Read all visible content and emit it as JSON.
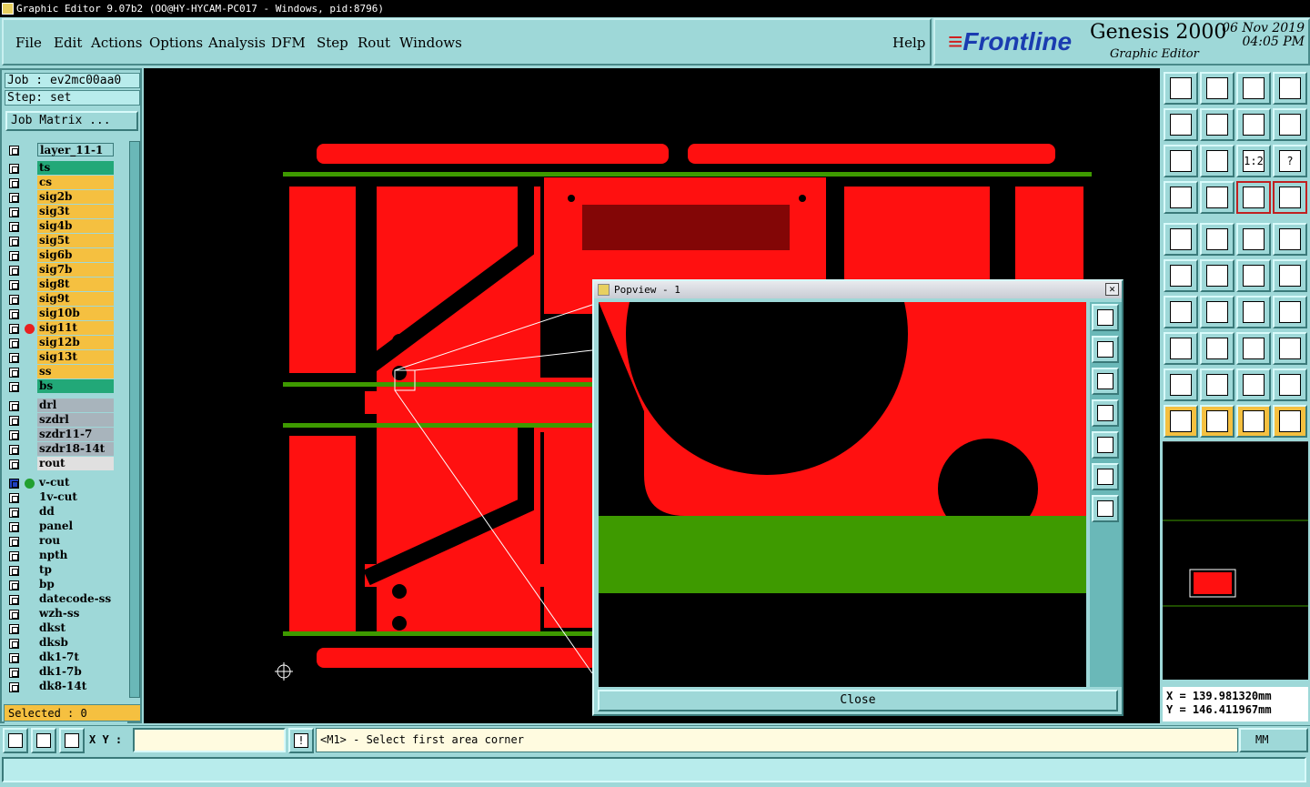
{
  "window": {
    "title": "Graphic Editor 9.07b2 (OO@HY-HYCAM-PC017 - Windows, pid:8796)"
  },
  "menu": {
    "items": [
      "File",
      "Edit",
      "Actions",
      "Options",
      "Analysis",
      "DFM",
      "Step",
      "Rout",
      "Windows"
    ],
    "help": "Help"
  },
  "brand": {
    "logo": "Frontline",
    "product": "Genesis 2000",
    "subtitle": "Graphic Editor",
    "date": "06 Nov 2019",
    "time": "04:05 PM"
  },
  "job": {
    "job_label": "Job : ev2mc00aa0",
    "step_label": "Step: set",
    "matrix_button": "Job Matrix ..."
  },
  "layers": {
    "header": "layer_11-1",
    "rows": [
      {
        "name": "ts",
        "color": "#22a878",
        "dot": ""
      },
      {
        "name": "cs",
        "color": "#f5c040",
        "dot": ""
      },
      {
        "name": "sig2b",
        "color": "#f5c040",
        "dot": ""
      },
      {
        "name": "sig3t",
        "color": "#f5c040",
        "dot": ""
      },
      {
        "name": "sig4b",
        "color": "#f5c040",
        "dot": ""
      },
      {
        "name": "sig5t",
        "color": "#f5c040",
        "dot": ""
      },
      {
        "name": "sig6b",
        "color": "#f5c040",
        "dot": ""
      },
      {
        "name": "sig7b",
        "color": "#f5c040",
        "dot": ""
      },
      {
        "name": "sig8t",
        "color": "#f5c040",
        "dot": ""
      },
      {
        "name": "sig9t",
        "color": "#f5c040",
        "dot": ""
      },
      {
        "name": "sig10b",
        "color": "#f5c040",
        "dot": ""
      },
      {
        "name": "sig11t",
        "color": "#f5c040",
        "dot": "#e82020"
      },
      {
        "name": "sig12b",
        "color": "#f5c040",
        "dot": ""
      },
      {
        "name": "sig13t",
        "color": "#f5c040",
        "dot": ""
      },
      {
        "name": "ss",
        "color": "#f5c040",
        "dot": ""
      },
      {
        "name": "bs",
        "color": "#22a878",
        "dot": ""
      },
      {
        "name": "drl",
        "color": "#a8b4bc",
        "dot": "",
        "gap": true
      },
      {
        "name": "szdrl",
        "color": "#a8b4bc",
        "dot": ""
      },
      {
        "name": "szdr11-7",
        "color": "#a8b4bc",
        "dot": ""
      },
      {
        "name": "szdr18-14t",
        "color": "#a8b4bc",
        "dot": ""
      },
      {
        "name": "rout",
        "color": "#e0e0e0",
        "dot": ""
      },
      {
        "name": "v-cut",
        "color": "#9ed8d8",
        "dot": "#22a030",
        "gap": true,
        "active": true
      },
      {
        "name": "1v-cut",
        "color": "#9ed8d8",
        "dot": ""
      },
      {
        "name": "dd",
        "color": "#9ed8d8",
        "dot": ""
      },
      {
        "name": "panel",
        "color": "#9ed8d8",
        "dot": ""
      },
      {
        "name": "rou",
        "color": "#9ed8d8",
        "dot": ""
      },
      {
        "name": "npth",
        "color": "#9ed8d8",
        "dot": ""
      },
      {
        "name": "tp",
        "color": "#9ed8d8",
        "dot": ""
      },
      {
        "name": "bp",
        "color": "#9ed8d8",
        "dot": ""
      },
      {
        "name": "datecode-ss",
        "color": "#9ed8d8",
        "dot": ""
      },
      {
        "name": "wzh-ss",
        "color": "#9ed8d8",
        "dot": ""
      },
      {
        "name": "dkst",
        "color": "#9ed8d8",
        "dot": ""
      },
      {
        "name": "dksb",
        "color": "#9ed8d8",
        "dot": ""
      },
      {
        "name": "dk1-7t",
        "color": "#9ed8d8",
        "dot": ""
      },
      {
        "name": "dk1-7b",
        "color": "#9ed8d8",
        "dot": ""
      },
      {
        "name": "dk8-14t",
        "color": "#9ed8d8",
        "dot": ""
      }
    ]
  },
  "selected": "Selected : 0",
  "toolbar_labels": {
    "ratio": "1:2",
    "help": "?"
  },
  "coords": {
    "x": "X = 139.981320mm",
    "y": "Y = 146.411967mm"
  },
  "popview": {
    "title": "Popview - 1",
    "close_label": "Close"
  },
  "status": {
    "xy_label": "X Y :",
    "xy_value": "",
    "message": "<M1> - Select first area corner",
    "unit": "MM"
  },
  "colors": {
    "copper": "#ff1010",
    "mask": "#3e9a00",
    "background": "#000000",
    "panel": "#9ed8d8"
  }
}
